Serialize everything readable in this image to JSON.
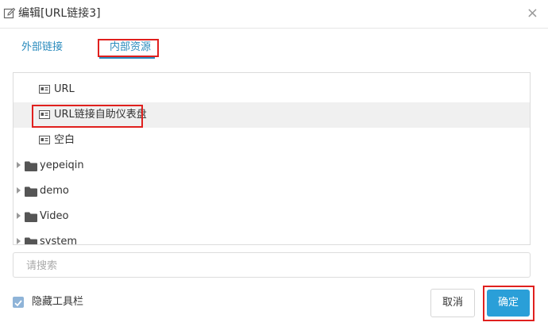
{
  "dialog": {
    "title": "编辑[URL链接3]",
    "close_glyph": "×"
  },
  "tabs": [
    {
      "label": "外部链接",
      "active": false
    },
    {
      "label": "内部资源",
      "active": true
    }
  ],
  "tree": {
    "items": [
      {
        "label": "URL",
        "type": "resource"
      },
      {
        "label": "URL链接自助仪表盘",
        "type": "resource",
        "selected": true
      },
      {
        "label": "空白",
        "type": "resource"
      },
      {
        "label": "yepeiqin",
        "type": "folder"
      },
      {
        "label": "demo",
        "type": "folder"
      },
      {
        "label": "Video",
        "type": "folder"
      },
      {
        "label": "system",
        "type": "folder"
      }
    ]
  },
  "search": {
    "placeholder": "请搜索",
    "value": ""
  },
  "options": {
    "hide_toolbar_label": "隐藏工具栏",
    "hide_toolbar_checked": true
  },
  "buttons": {
    "cancel": "取消",
    "ok": "确定"
  },
  "colors": {
    "accent": "#2a9fd8",
    "tab_text": "#2a8bbd",
    "highlight_box": "#e0201e",
    "checkbox": "#8fb4d8"
  },
  "icons": {
    "title": "edit-icon",
    "close": "close-icon",
    "resource": "dashboard-resource-icon",
    "folder": "folder-icon",
    "expand": "caret-right-icon"
  }
}
